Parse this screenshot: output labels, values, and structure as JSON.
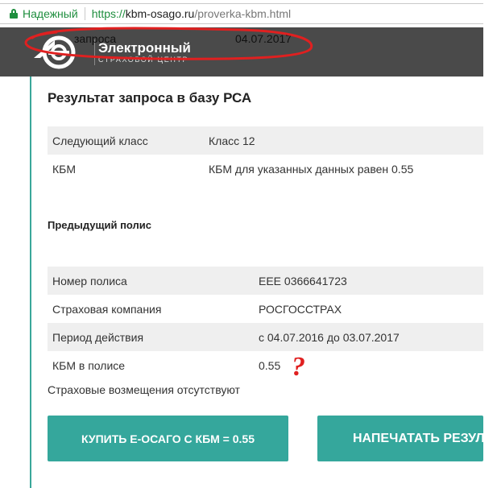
{
  "browser": {
    "secure_label": "Надежный",
    "url_scheme": "https://",
    "url_host": "kbm-osago.ru",
    "url_path": "/proverka-kbm.html",
    "icons": [
      "lock-icon"
    ]
  },
  "header": {
    "brand_title": "Электронный",
    "brand_subtitle": "СТРАХОВОЙ ЦЕНТР",
    "request_label": "запроса",
    "request_date": "04.07.2017"
  },
  "result": {
    "title": "Результат запроса в базу РСА",
    "rows": [
      {
        "key": "Следующий класс",
        "value": "Класс 12"
      },
      {
        "key": "КБМ",
        "value": "КБМ для указанных данных равен 0.55"
      }
    ]
  },
  "previous_policy": {
    "title": "Предыдущий полис",
    "rows": [
      {
        "key": "Номер полиса",
        "value": "ЕЕЕ 0366641723"
      },
      {
        "key": "Страховая компания",
        "value": "РОСГОССТРАХ"
      },
      {
        "key": "Период действия",
        "value": "с 04.07.2016 до 03.07.2017"
      },
      {
        "key": "КБМ в полисе",
        "value": "0.55"
      }
    ],
    "note": "Страховые возмещения отсутствуют"
  },
  "buttons": {
    "buy": "КУПИТЬ Е-ОСАГО С КБМ = 0.55",
    "print": "НАПЕЧАТАТЬ РЕЗУЛ"
  },
  "annotation": {
    "mark": "?",
    "color": "#e02020"
  },
  "colors": {
    "accent": "#35a79c",
    "header_bg": "#4a4a4a",
    "secure_green": "#1e8e3e"
  }
}
